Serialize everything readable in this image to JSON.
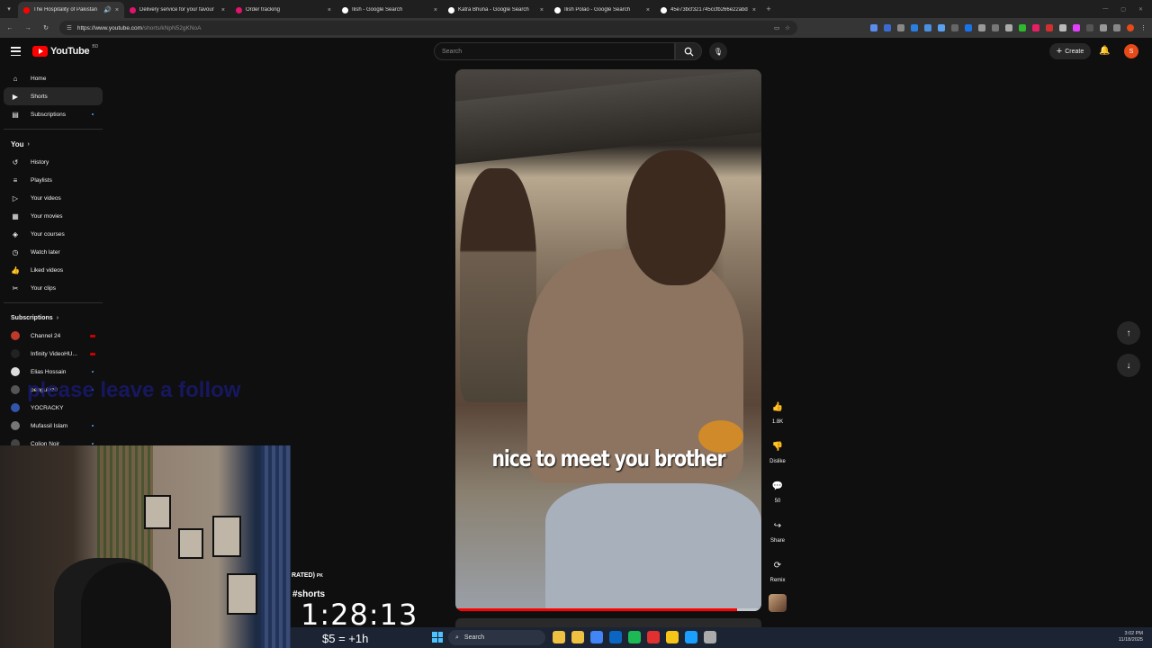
{
  "browser": {
    "tabs": [
      {
        "title": "The Hospitality of Pakistan",
        "active": true,
        "favicon_color": "#ff0000"
      },
      {
        "title": "Delivery service for your favour",
        "active": false,
        "favicon_color": "#e2136e"
      },
      {
        "title": "Order tracking",
        "active": false,
        "favicon_color": "#e2136e"
      },
      {
        "title": "Ilish - Google Search",
        "active": false,
        "favicon_color": "#ffffff"
      },
      {
        "title": "Katra Bhuna - Google Search",
        "active": false,
        "favicon_color": "#ffffff"
      },
      {
        "title": "Ilish Polao - Google Search",
        "active": false,
        "favicon_color": "#ffffff"
      },
      {
        "title": "45e73bcf321745ccfb266e22abd",
        "active": false,
        "favicon_color": "#ffffff"
      }
    ],
    "url_host": "https://www.youtube.com",
    "url_path": "/shorts/kNpN52gKNoA"
  },
  "header": {
    "logo_text": "YouTube",
    "logo_sup": "BD",
    "search_placeholder": "Search",
    "create_label": "Create",
    "avatar_letter": "S"
  },
  "sidebar": {
    "main": [
      {
        "label": "Home",
        "icon": "home-icon",
        "glyph": "⌂"
      },
      {
        "label": "Shorts",
        "icon": "shorts-icon",
        "glyph": "▶",
        "active": true
      },
      {
        "label": "Subscriptions",
        "icon": "subscriptions-icon",
        "glyph": "▤"
      }
    ],
    "you_label": "You",
    "you_items": [
      {
        "label": "History",
        "icon": "history-icon",
        "glyph": "↺"
      },
      {
        "label": "Playlists",
        "icon": "playlists-icon",
        "glyph": "≡"
      },
      {
        "label": "Your videos",
        "icon": "your-videos-icon",
        "glyph": "▷"
      },
      {
        "label": "Your movies",
        "icon": "movies-icon",
        "glyph": "▦"
      },
      {
        "label": "Your courses",
        "icon": "courses-icon",
        "glyph": "◈"
      },
      {
        "label": "Watch later",
        "icon": "watch-later-icon",
        "glyph": "◷"
      },
      {
        "label": "Liked videos",
        "icon": "liked-icon",
        "glyph": "👍"
      },
      {
        "label": "Your clips",
        "icon": "clips-icon",
        "glyph": "✂"
      }
    ],
    "subs_label": "Subscriptions",
    "subscriptions": [
      {
        "label": "Channel 24",
        "color": "#c0392b",
        "badge": "live"
      },
      {
        "label": "Infinity VideoHU...",
        "color": "#222222",
        "badge": "live"
      },
      {
        "label": "Elias Hossain",
        "color": "#dddddd",
        "badge": "dot"
      },
      {
        "label": "penguinz0",
        "color": "#555555",
        "badge": "dot"
      },
      {
        "label": "YOCRACKY",
        "color": "#3355aa",
        "badge": "none"
      },
      {
        "label": "Mufassil Islam",
        "color": "#777777",
        "badge": "dot"
      },
      {
        "label": "Colion Noir",
        "color": "#444444",
        "badge": "dot"
      }
    ]
  },
  "video": {
    "caption": "nice to meet you brother",
    "progress": 0.92
  },
  "actions": {
    "likes": "1.8K",
    "dislike_label": "Dislike",
    "comments": "50",
    "share_label": "Share",
    "remix_label": "Remix"
  },
  "stream_overlay": {
    "follow_text": "please leave a follow",
    "rated_text": "RATED)",
    "rated_flag": "PK",
    "shorts_tag": "#shorts",
    "timer": "1:28:13",
    "donation": "$5 = +1h"
  },
  "taskbar": {
    "search_label": "Search",
    "time": "3:02 PM",
    "date": "11/18/2025",
    "app_colors": [
      "#f0c040",
      "#f0c040",
      "#4285f4",
      "#0a66c2",
      "#1db954",
      "#e03030",
      "#f5c518",
      "#1a9fff",
      "#aaaaaa"
    ]
  }
}
